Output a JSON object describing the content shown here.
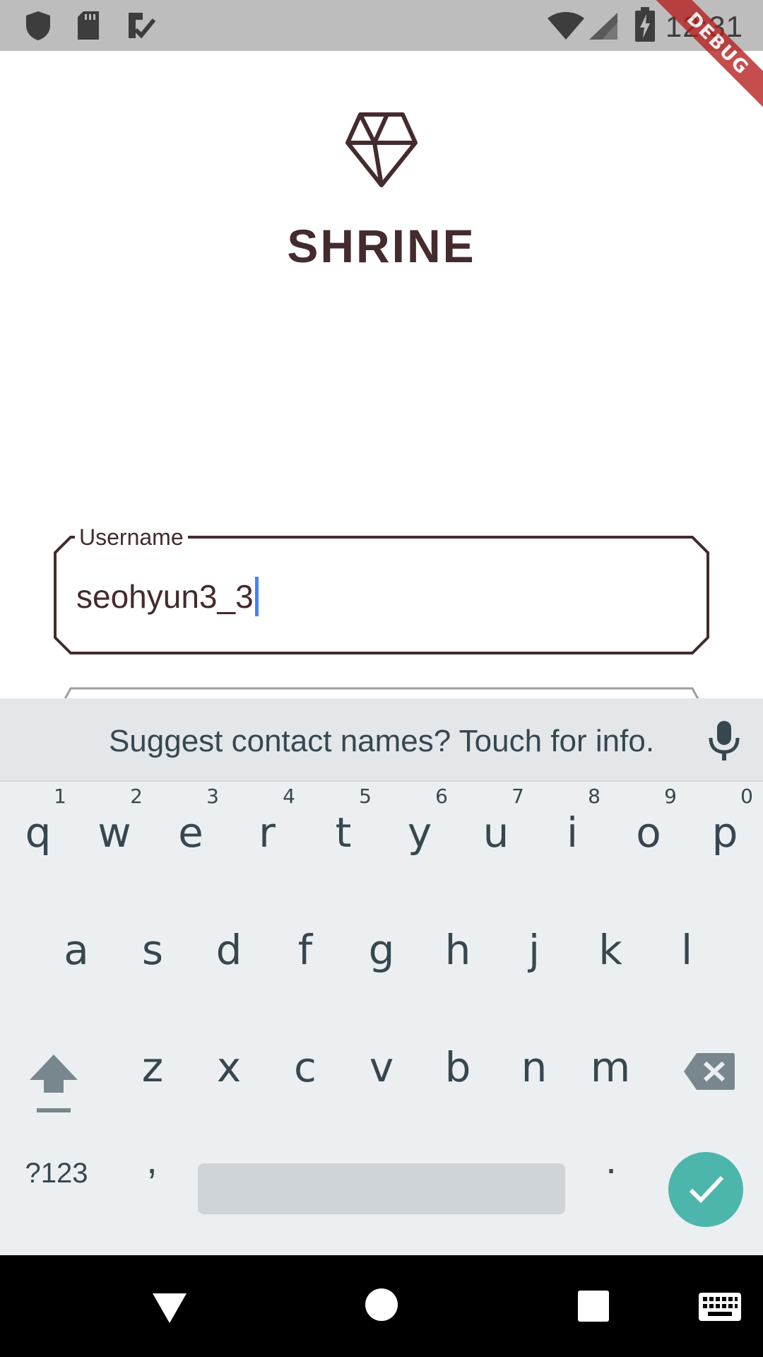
{
  "status_bar": {
    "time": "12:31",
    "icons": [
      "shield-icon",
      "sd-card-icon",
      "task-check-icon",
      "wifi-icon",
      "signal-icon",
      "battery-charging-icon"
    ]
  },
  "debug_banner": {
    "text": "DEBUG"
  },
  "app": {
    "logo_icon": "diamond-icon",
    "title": "SHRINE"
  },
  "login_form": {
    "username": {
      "label": "Username",
      "value": "seohyun3_3"
    }
  },
  "keyboard": {
    "suggestion": "Suggest contact names? Touch for info.",
    "row1": [
      {
        "ch": "q",
        "num": "1"
      },
      {
        "ch": "w",
        "num": "2"
      },
      {
        "ch": "e",
        "num": "3"
      },
      {
        "ch": "r",
        "num": "4"
      },
      {
        "ch": "t",
        "num": "5"
      },
      {
        "ch": "y",
        "num": "6"
      },
      {
        "ch": "u",
        "num": "7"
      },
      {
        "ch": "i",
        "num": "8"
      },
      {
        "ch": "o",
        "num": "9"
      },
      {
        "ch": "p",
        "num": "0"
      }
    ],
    "row2": [
      "a",
      "s",
      "d",
      "f",
      "g",
      "h",
      "j",
      "k",
      "l"
    ],
    "row3": [
      "z",
      "x",
      "c",
      "v",
      "b",
      "n",
      "m"
    ],
    "symbols_label": "?123",
    "comma_label": ",",
    "period_label": "."
  },
  "colors": {
    "brand": "#442b2d",
    "accent_enter": "#4db6ac",
    "caret": "#4285f4",
    "keyboard_bg": "#eceff1"
  }
}
